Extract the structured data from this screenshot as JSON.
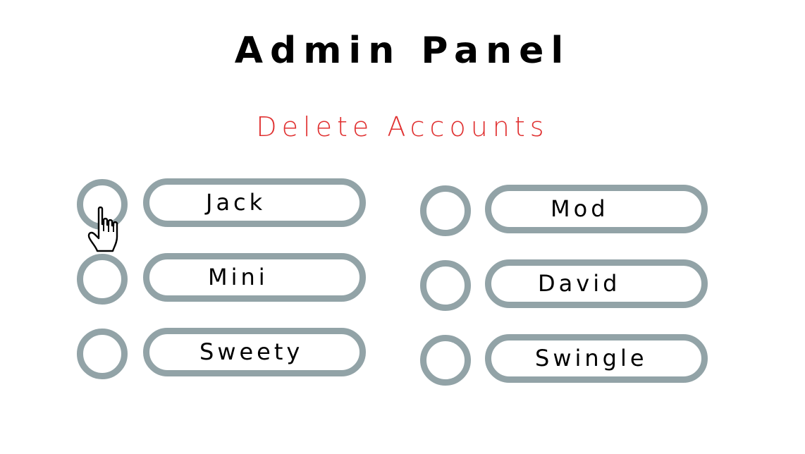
{
  "header": {
    "title": "Admin Panel",
    "subtitle": "Delete Accounts"
  },
  "colors": {
    "title": "#000000",
    "subtitle": "#e03131",
    "control_border": "#92a3a7",
    "background": "#ffffff"
  },
  "accounts": {
    "left": [
      {
        "label": "Jack",
        "selected": false
      },
      {
        "label": "Mini",
        "selected": false
      },
      {
        "label": "Sweety",
        "selected": false
      }
    ],
    "right": [
      {
        "label": "Mod",
        "selected": false
      },
      {
        "label": "David",
        "selected": false
      },
      {
        "label": "Swingle",
        "selected": false
      }
    ]
  },
  "cursor": {
    "icon": "hand-pointer-icon"
  }
}
